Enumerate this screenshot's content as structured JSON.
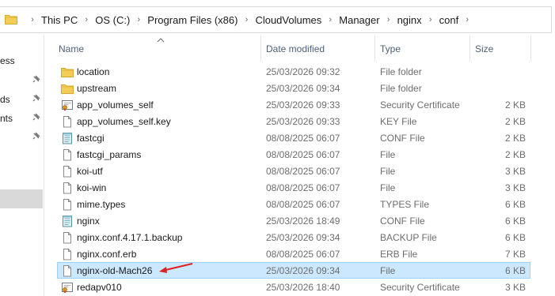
{
  "address": {
    "crumbs": [
      "This PC",
      "OS (C:)",
      "Program Files (x86)",
      "CloudVolumes",
      "Manager",
      "nginx",
      "conf"
    ],
    "folder_icon": "folder-icon",
    "separator_icon": "chevron-right-icon"
  },
  "nav": {
    "items": [
      {
        "label": "ess",
        "pinned": false
      },
      {
        "label": "ds",
        "pinned": true
      },
      {
        "label": "nts",
        "pinned": true
      }
    ]
  },
  "columns": {
    "name": "Name",
    "date": "Date modified",
    "type": "Type",
    "size": "Size"
  },
  "files": [
    {
      "name": "location",
      "date": "25/03/2026 09:32",
      "type": "File folder",
      "size": "",
      "icon": "folder-icon"
    },
    {
      "name": "upstream",
      "date": "25/03/2026 09:34",
      "type": "File folder",
      "size": "",
      "icon": "folder-icon"
    },
    {
      "name": "app_volumes_self",
      "date": "25/03/2026 09:33",
      "type": "Security Certificate",
      "size": "2 KB",
      "icon": "certificate-icon"
    },
    {
      "name": "app_volumes_self.key",
      "date": "25/03/2026 09:33",
      "type": "KEY File",
      "size": "2 KB",
      "icon": "file-icon"
    },
    {
      "name": "fastcgi",
      "date": "08/08/2025 06:07",
      "type": "CONF File",
      "size": "2 KB",
      "icon": "notepad-icon"
    },
    {
      "name": "fastcgi_params",
      "date": "08/08/2025 06:07",
      "type": "File",
      "size": "2 KB",
      "icon": "file-icon"
    },
    {
      "name": "koi-utf",
      "date": "08/08/2025 06:07",
      "type": "File",
      "size": "3 KB",
      "icon": "file-icon"
    },
    {
      "name": "koi-win",
      "date": "08/08/2025 06:07",
      "type": "File",
      "size": "3 KB",
      "icon": "file-icon"
    },
    {
      "name": "mime.types",
      "date": "08/08/2025 06:07",
      "type": "TYPES File",
      "size": "6 KB",
      "icon": "file-icon"
    },
    {
      "name": "nginx",
      "date": "25/03/2026 18:49",
      "type": "CONF File",
      "size": "6 KB",
      "icon": "notepad-icon"
    },
    {
      "name": "nginx.conf.4.17.1.backup",
      "date": "25/03/2026 09:34",
      "type": "BACKUP File",
      "size": "6 KB",
      "icon": "file-icon"
    },
    {
      "name": "nginx.conf.erb",
      "date": "08/08/2025 06:07",
      "type": "ERB File",
      "size": "7 KB",
      "icon": "file-icon"
    },
    {
      "name": "nginx-old-Mach26",
      "date": "25/03/2026 09:34",
      "type": "File",
      "size": "6 KB",
      "icon": "file-icon",
      "selected": true
    },
    {
      "name": "redapv010",
      "date": "25/03/2026 18:40",
      "type": "Security Certificate",
      "size": "3 KB",
      "icon": "certificate-icon"
    }
  ],
  "colors": {
    "selection_bg": "#cce8ff",
    "selection_border": "#99d1ff",
    "folder": "#f0c54a",
    "annotation_arrow": "#e02020",
    "header_text": "#4c607a"
  },
  "annotation": {
    "arrow_target": "nginx-old-Mach26"
  }
}
